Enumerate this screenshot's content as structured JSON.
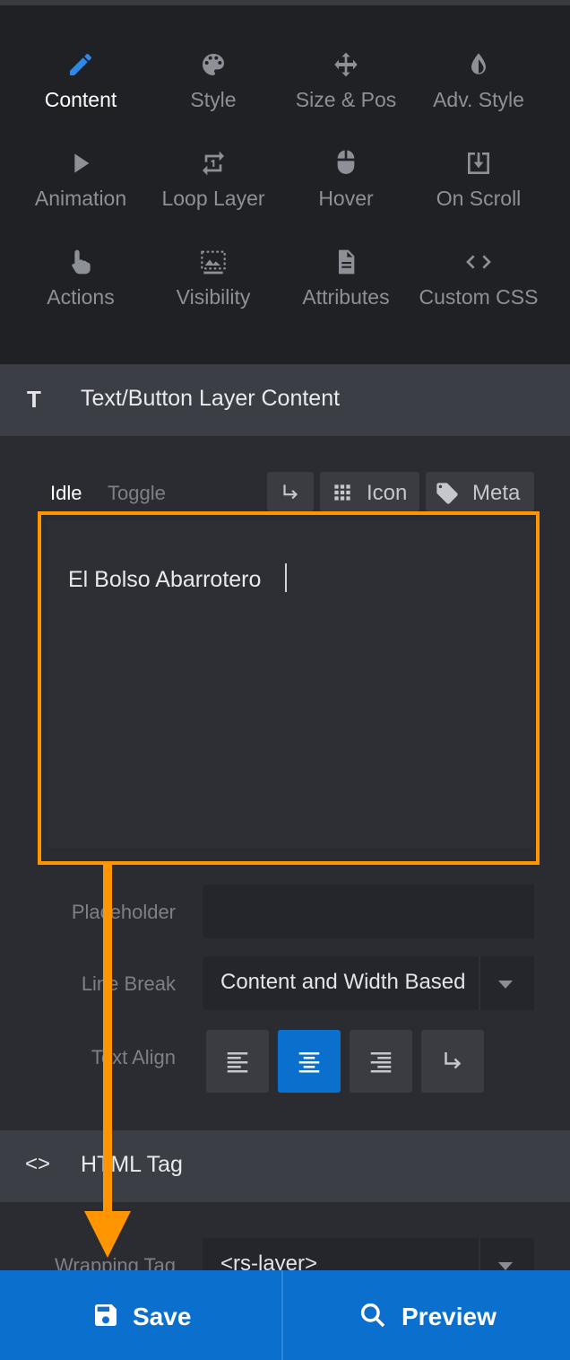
{
  "tabs": [
    {
      "label": "Content",
      "icon": "pencil-icon",
      "active": true
    },
    {
      "label": "Style",
      "icon": "palette-icon"
    },
    {
      "label": "Size & Pos",
      "icon": "move-arrows-icon"
    },
    {
      "label": "Adv. Style",
      "icon": "drop-icon"
    },
    {
      "label": "Animation",
      "icon": "play-icon"
    },
    {
      "label": "Loop Layer",
      "icon": "loop-icon"
    },
    {
      "label": "Hover",
      "icon": "mouse-icon"
    },
    {
      "label": "On Scroll",
      "icon": "scroll-download-icon"
    },
    {
      "label": "Actions",
      "icon": "pointer-hand-icon"
    },
    {
      "label": "Visibility",
      "icon": "visibility-image-icon"
    },
    {
      "label": "Attributes",
      "icon": "document-icon"
    },
    {
      "label": "Custom CSS",
      "icon": "code-icon"
    }
  ],
  "content_section": {
    "icon_glyph": "T",
    "title": "Text/Button Layer Content",
    "modes": {
      "idle": "Idle",
      "toggle": "Toggle"
    },
    "icon_button": "Icon",
    "meta_button": "Meta",
    "editor_text": "El Bolso Abarrotero"
  },
  "fields": {
    "placeholder_label": "Placeholder",
    "placeholder_value": "",
    "line_break_label": "Line Break",
    "line_break_value": "Content and Width Based",
    "text_align_label": "Text Align"
  },
  "html_section": {
    "icon_glyph": "<>",
    "title": "HTML Tag",
    "wrapping_tag_label": "Wrapping Tag",
    "wrapping_tag_value": "<rs-layer>"
  },
  "footer": {
    "save_label": "Save",
    "preview_label": "Preview"
  },
  "colors": {
    "accent": "#0b6fce",
    "highlight": "#ff9500",
    "panel": "#2b2c31",
    "tabs_bg": "#202124"
  }
}
